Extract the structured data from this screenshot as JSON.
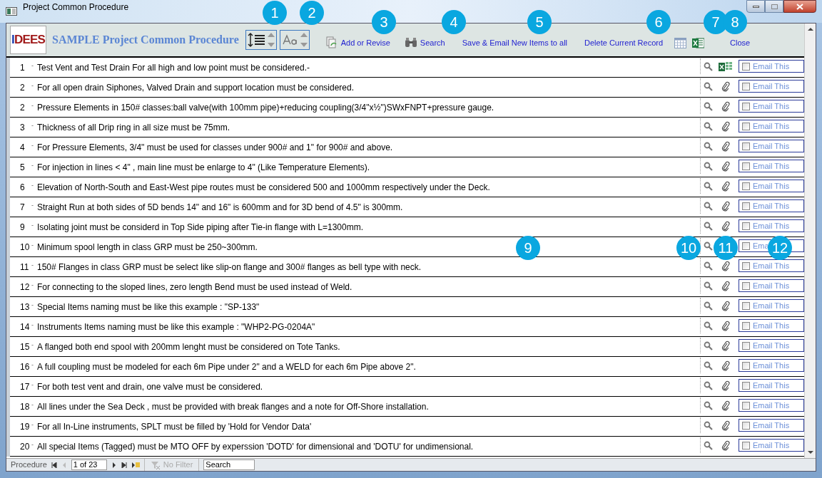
{
  "window": {
    "title": "Project Common Procedure"
  },
  "header": {
    "logo": "IDEES",
    "title": "SAMPLE Project Common Procedure",
    "links": [
      {
        "kind": "add",
        "label": "Add or Revise"
      },
      {
        "kind": "search",
        "label": "Search"
      },
      {
        "kind": "plain",
        "label": "Save & Email New Items to all"
      },
      {
        "kind": "plain",
        "label": "Delete Current Record"
      },
      {
        "kind": "calendar"
      },
      {
        "kind": "excel"
      },
      {
        "kind": "close",
        "label": "Close"
      }
    ]
  },
  "rows": [
    {
      "number": "1",
      "marker": "-",
      "text": "Test Vent and Test Drain For all high and low point must be considered.-",
      "kind": "sheet",
      "email_label": "Email This",
      "checked": false
    },
    {
      "number": "2",
      "marker": "-",
      "text": "For all open drain Siphones, Valved Drain and support location must be considered.",
      "kind": "clip",
      "email_label": "Email This",
      "checked": false
    },
    {
      "number": "2",
      "marker": "-",
      "text": "Pressure Elements in 150# classes:ball valve(with 100mm pipe)+reducing coupling(3/4\"x½\")SWxFNPT+pressure gauge.",
      "kind": "clip",
      "email_label": "Email This",
      "checked": false
    },
    {
      "number": "3",
      "marker": "-",
      "text": "Thickness of all Drip ring in all size must be 75mm.",
      "kind": "clip",
      "email_label": "Email This",
      "checked": false
    },
    {
      "number": "4",
      "marker": "-",
      "text": "For Pressure Elements, 3/4\" must be used for classes under 900# and 1\" for 900# and above.",
      "kind": "clip",
      "email_label": "Email This",
      "checked": false
    },
    {
      "number": "5",
      "marker": "-",
      "text": "For injection in lines < 4\" , main line must be enlarge to 4\" (Like Temperature Elements).",
      "kind": "clip",
      "email_label": "Email This",
      "checked": false
    },
    {
      "number": "6",
      "marker": "-",
      "text": "Elevation of North-South and East-West pipe routes must be considered 500 and 1000mm respectively under the Deck.",
      "kind": "clip",
      "email_label": "Email This",
      "checked": false
    },
    {
      "number": "7",
      "marker": "-",
      "text": "Straight Run at both sides of 5D bends 14\" and 16\" is 600mm and for 3D bend of 4.5\" is 300mm.",
      "kind": "clip",
      "email_label": "Email This",
      "checked": false
    },
    {
      "number": "9",
      "marker": "-",
      "text": "Isolating joint must be considerd in Top Side piping after Tie-in flange with L=1300mm.",
      "kind": "clip",
      "email_label": "Email This",
      "checked": false
    },
    {
      "number": "10",
      "marker": "-",
      "text": "Minimum spool length in class GRP must be 250~300mm.",
      "kind": "none",
      "email_label": "Ema",
      "checked": false
    },
    {
      "number": "11",
      "marker": "-",
      "text": "150# Flanges in class GRP must be select like slip-on flange and 300# flanges as bell type with neck.",
      "kind": "clip",
      "email_label": "Email This",
      "checked": false
    },
    {
      "number": "12",
      "marker": "-",
      "text": "For connecting to the sloped lines, zero length Bend must be used instead of Weld.",
      "kind": "clip",
      "email_label": "Email This",
      "checked": false
    },
    {
      "number": "13",
      "marker": "-",
      "text": "Special Items naming must be like this example : \"SP-133\"",
      "kind": "clip",
      "email_label": "Email This",
      "checked": false
    },
    {
      "number": "14",
      "marker": "-",
      "text": "Instruments Items naming must be like this example : \"WHP2-PG-0204A\"",
      "kind": "clip",
      "email_label": "Email This",
      "checked": false
    },
    {
      "number": "15",
      "marker": "-",
      "text": "A flanged both end spool with 200mm lenght must be considered on Tote Tanks.",
      "kind": "clip",
      "email_label": "Email This",
      "checked": false
    },
    {
      "number": "16",
      "marker": "-",
      "text": "A full coupling must be modeled for each 6m Pipe under 2\" and a WELD for each 6m Pipe above 2\".",
      "kind": "clip",
      "email_label": "Email This",
      "checked": false
    },
    {
      "number": "17",
      "marker": "-",
      "text": "For both test vent and drain, one valve must be considered.",
      "kind": "clip",
      "email_label": "Email This",
      "checked": false
    },
    {
      "number": "18",
      "marker": "-",
      "text": "All lines under the Sea Deck , must be provided with break flanges and a note for Off-Shore installation.",
      "kind": "clip",
      "email_label": "Email This",
      "checked": false
    },
    {
      "number": "19",
      "marker": "-",
      "text": "For all In-Line instruments, SPLT must be filled by 'Hold for Vendor Data'",
      "kind": "clip",
      "email_label": "Email This",
      "checked": false
    },
    {
      "number": "20",
      "marker": "-",
      "text": "All special Items (Tagged) must be MTO OFF by experssion 'DOTD' for dimensional and 'DOTU' for undimensional.",
      "kind": "clip",
      "email_label": "Email This",
      "checked": false
    }
  ],
  "status_bar": {
    "label": "Procedure",
    "record": "1 of 23",
    "filter": "No Filter",
    "filter_disabled": true,
    "search_placeholder": "Search"
  },
  "callouts": [
    {
      "label": "1"
    },
    {
      "label": "2"
    },
    {
      "label": "3"
    },
    {
      "label": "4"
    },
    {
      "label": "5"
    },
    {
      "label": "6"
    },
    {
      "label": "7"
    },
    {
      "label": "8"
    },
    {
      "label": "9"
    },
    {
      "label": "10"
    },
    {
      "label": "11"
    },
    {
      "label": "12"
    }
  ]
}
